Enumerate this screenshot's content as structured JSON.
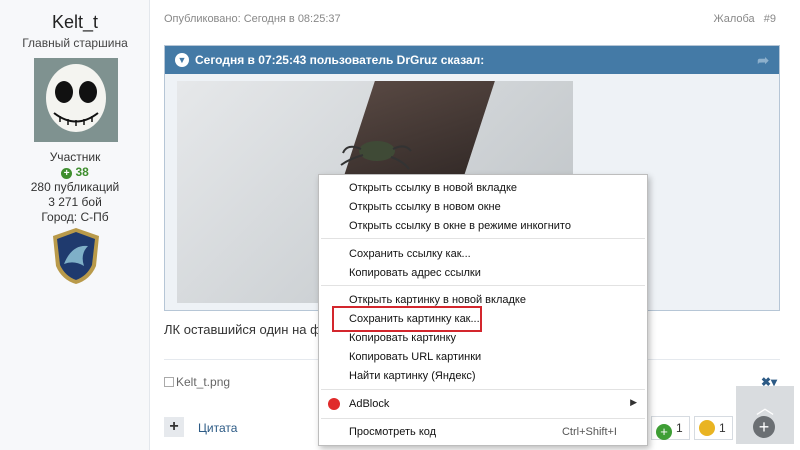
{
  "author": {
    "name": "Kelt_t",
    "rank": "Главный старшина",
    "group": "Участник",
    "reputation": "38",
    "posts": "280 публикаций",
    "fights": "3 271 бой",
    "city": "Город: С-Пб"
  },
  "post": {
    "published": "Опубликовано: Сегодня в 08:25:37",
    "report": "Жалоба",
    "number": "#9",
    "quote_header": "Сегодня в 07:25:43 пользователь DrGruz сказал:",
    "text": "ЛК оставшийся один на фла",
    "signature": "Kelt_t.png",
    "quote_button": "Цитата",
    "reactions": [
      {
        "count": "1",
        "color": "#3e9e35"
      },
      {
        "count": "1",
        "color": "#e9b422"
      }
    ]
  },
  "context_menu": {
    "items": [
      "Открыть ссылку в новой вкладке",
      "Открыть ссылку в новом окне",
      "Открыть ссылку в окне в режиме инкогнито",
      "Сохранить ссылку как...",
      "Копировать адрес ссылки",
      "Открыть картинку в новой вкладке",
      "Сохранить картинку как...",
      "Копировать картинку",
      "Копировать URL картинки",
      "Найти картинку (Яндекс)",
      "AdBlock",
      "Просмотреть код"
    ],
    "shortcut": "Ctrl+Shift+I",
    "highlighted_item": "Сохранить картинку как...",
    "highlight_color": "#d3262d"
  },
  "icons": {
    "collapse": "chevron-down-icon",
    "share": "share-icon",
    "adblock": "adblock-icon",
    "submenu": "arrow-right-icon",
    "add": "plus-icon",
    "scroll_top": "chevron-up-icon",
    "close": "close-icon"
  }
}
